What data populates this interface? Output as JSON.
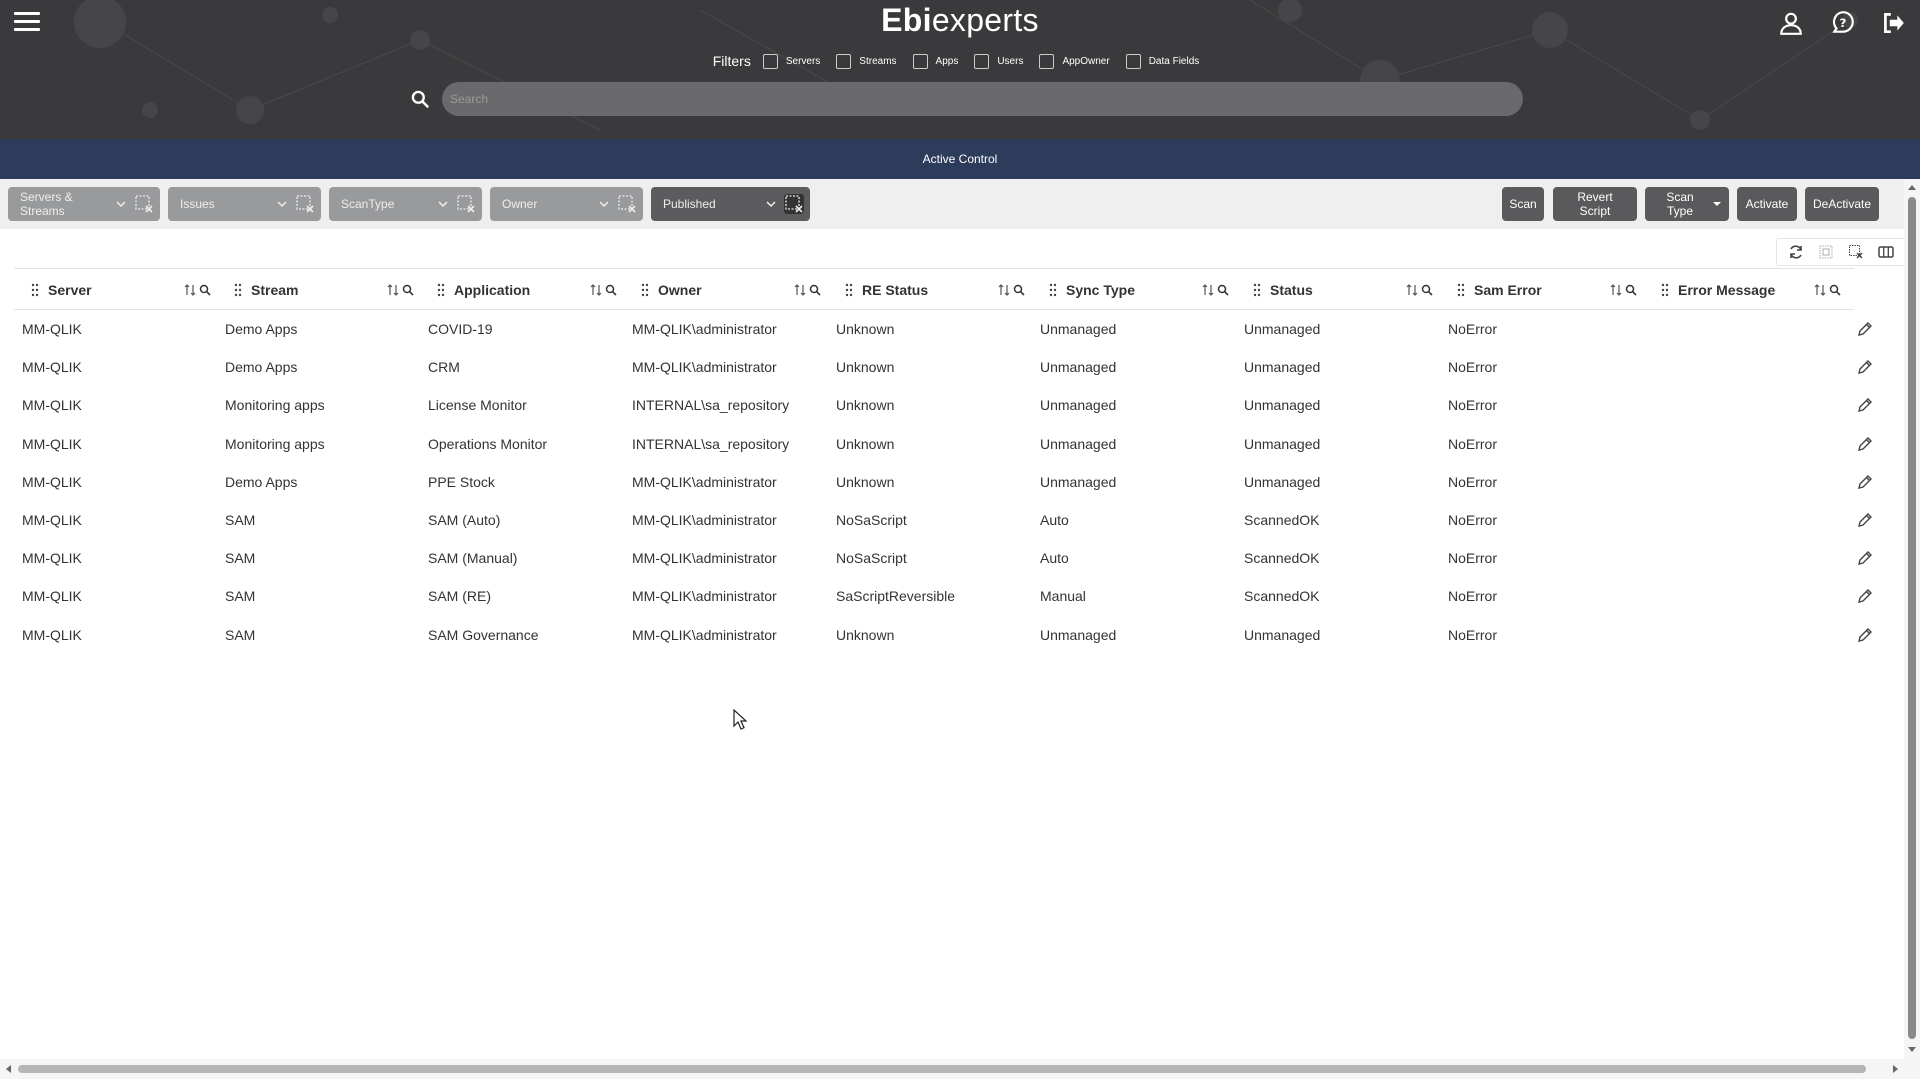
{
  "header": {
    "brand_bold": "Ebi",
    "brand_regular": "experts",
    "filters_label": "Filters",
    "filters": [
      "Servers",
      "Streams",
      "Apps",
      "Users",
      "AppOwner",
      "Data Fields"
    ],
    "search_placeholder": "Search",
    "icons": [
      "hamburger-menu-icon",
      "user-icon",
      "help-icon",
      "logout-icon",
      "search-icon"
    ]
  },
  "page": {
    "title": "Active Control"
  },
  "toolbar": {
    "selects": [
      {
        "label": "Servers & Streams",
        "active": false
      },
      {
        "label": "Issues",
        "active": false
      },
      {
        "label": "ScanType",
        "active": false
      },
      {
        "label": "Owner",
        "active": false
      },
      {
        "label": "Published",
        "active": true
      }
    ],
    "buttons": {
      "scan": "Scan",
      "revert_script": "Revert Script",
      "scan_type": "Scan Type",
      "activate": "Activate",
      "deactivate": "DeActivate"
    }
  },
  "table": {
    "columns": [
      "Server",
      "Stream",
      "Application",
      "Owner",
      "RE Status",
      "Sync Type",
      "Status",
      "Sam Error",
      "Error Message"
    ],
    "rows": [
      [
        "MM-QLIK",
        "Demo Apps",
        "COVID-19",
        "MM-QLIK\\administrator",
        "Unknown",
        "Unmanaged",
        "Unmanaged",
        "NoError",
        ""
      ],
      [
        "MM-QLIK",
        "Demo Apps",
        "CRM",
        "MM-QLIK\\administrator",
        "Unknown",
        "Unmanaged",
        "Unmanaged",
        "NoError",
        ""
      ],
      [
        "MM-QLIK",
        "Monitoring apps",
        "License Monitor",
        "INTERNAL\\sa_repository",
        "Unknown",
        "Unmanaged",
        "Unmanaged",
        "NoError",
        ""
      ],
      [
        "MM-QLIK",
        "Monitoring apps",
        "Operations Monitor",
        "INTERNAL\\sa_repository",
        "Unknown",
        "Unmanaged",
        "Unmanaged",
        "NoError",
        ""
      ],
      [
        "MM-QLIK",
        "Demo Apps",
        "PPE Stock",
        "MM-QLIK\\administrator",
        "Unknown",
        "Unmanaged",
        "Unmanaged",
        "NoError",
        ""
      ],
      [
        "MM-QLIK",
        "SAM",
        "SAM (Auto)",
        "MM-QLIK\\administrator",
        "NoSaScript",
        "Auto",
        "ScannedOK",
        "NoError",
        ""
      ],
      [
        "MM-QLIK",
        "SAM",
        "SAM (Manual)",
        "MM-QLIK\\administrator",
        "NoSaScript",
        "Auto",
        "ScannedOK",
        "NoError",
        ""
      ],
      [
        "MM-QLIK",
        "SAM",
        "SAM (RE)",
        "MM-QLIK\\administrator",
        "SaScriptReversible",
        "Manual",
        "ScannedOK",
        "NoError",
        ""
      ],
      [
        "MM-QLIK",
        "SAM",
        "SAM Governance",
        "MM-QLIK\\administrator",
        "Unknown",
        "Unmanaged",
        "Unmanaged",
        "NoError",
        ""
      ]
    ]
  },
  "colors": {
    "header_bg": "#3a3a3c",
    "title_bar_bg": "#2d3c5a",
    "button_bg": "#5a5a5c",
    "select_bg": "#999a9c"
  }
}
